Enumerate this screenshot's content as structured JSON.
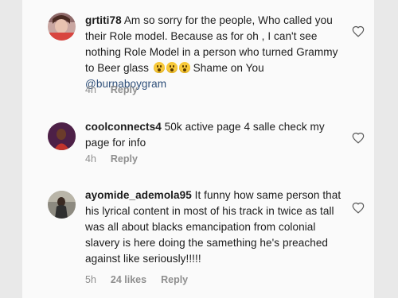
{
  "comments": [
    {
      "username": "grtiti78",
      "text": "Am so sorry for the people,  Who called you their Role model.  Because as for oh , I can't see nothing Role Model in a person who  turned Grammy to Beer glass",
      "emoji": "hushed-face-emoji ×3",
      "text_after": "Shame on You",
      "mention": "@burnaboygram",
      "time": "4h",
      "likes": "",
      "reply_label": "Reply"
    },
    {
      "username": "coolconnects4",
      "text": "50k active page 4 salle check my page for info",
      "time": "4h",
      "likes": "",
      "reply_label": "Reply"
    },
    {
      "username": "ayomide_ademola95",
      "text": "It funny how same person that his lyrical content in most of his track in twice as tall was all about blacks emancipation from colonial slavery is here doing the samething he's preached against like seriously!!!!!",
      "time": "5h",
      "likes": "24 likes",
      "reply_label": "Reply"
    }
  ],
  "icons": {
    "like": "heart-outline-icon",
    "avatar": "user-avatar"
  },
  "colors": {
    "background": "#fafafa",
    "text": "#1c1c1c",
    "meta": "#8e8e8e",
    "mention": "#2e4f7a",
    "frame": "#e9e9e9"
  }
}
